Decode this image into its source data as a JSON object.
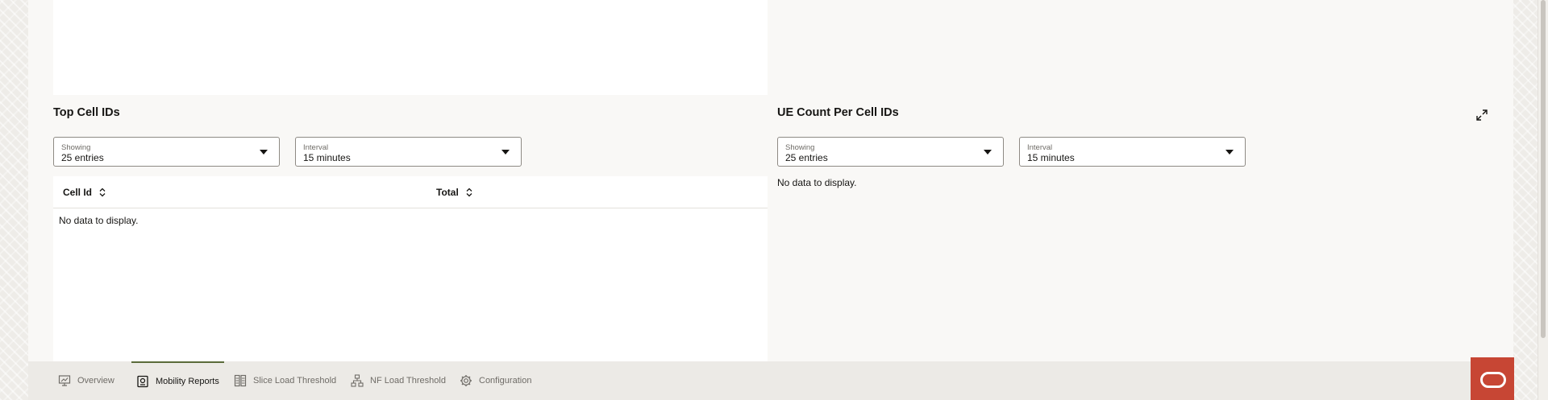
{
  "sections": {
    "top_cell_ids": {
      "title": "Top Cell IDs",
      "showing": {
        "label": "Showing",
        "value": "25 entries"
      },
      "interval": {
        "label": "Interval",
        "value": "15 minutes"
      },
      "table": {
        "columns": [
          "Cell Id",
          "Total"
        ],
        "empty_text": "No data to display."
      }
    },
    "ue_count": {
      "title": "UE Count Per Cell IDs",
      "showing": {
        "label": "Showing",
        "value": "25 entries"
      },
      "interval": {
        "label": "Interval",
        "value": "15 minutes"
      },
      "empty_text": "No data to display.",
      "expand_icon": "expand-icon"
    }
  },
  "bottom_nav": {
    "tabs": [
      {
        "label": "Overview",
        "icon": "monitor-chart-icon",
        "active": false
      },
      {
        "label": "Mobility Reports",
        "icon": "report-icon",
        "active": true
      },
      {
        "label": "Slice Load Threshold",
        "icon": "columns-icon",
        "active": false
      },
      {
        "label": "NF Load Threshold",
        "icon": "network-icon",
        "active": false
      },
      {
        "label": "Configuration",
        "icon": "gear-icon",
        "active": false
      }
    ]
  },
  "colors": {
    "accent": "#5b6b3a",
    "oracle_red": "#c74634",
    "page_bg": "#f9f8f6"
  }
}
